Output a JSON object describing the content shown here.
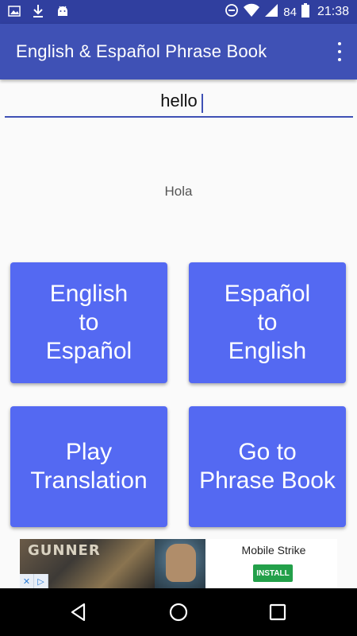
{
  "status_bar": {
    "battery_percent": "84",
    "time": "21:38",
    "left_icons": [
      "image-icon",
      "download-icon",
      "android-icon"
    ],
    "right_icons": [
      "sync-icon",
      "wifi-icon",
      "signal-icon",
      "battery-icon"
    ]
  },
  "app_bar": {
    "title": "English & Español Phrase Book",
    "menu_icon": "overflow-menu-icon"
  },
  "search": {
    "value": "hello",
    "placeholder": ""
  },
  "translation": {
    "text": "Hola"
  },
  "buttons": [
    {
      "label": "English\nto\nEspañol"
    },
    {
      "label": "Español\nto\nEnglish"
    },
    {
      "label": "Play\nTranslation"
    },
    {
      "label": "Go to\nPhrase Book"
    }
  ],
  "ad": {
    "banner_text": "GUNNER",
    "title": "Mobile Strike",
    "install_label": "INSTALL"
  },
  "nav_bar": {
    "icons": [
      "back-icon",
      "home-icon",
      "recents-icon"
    ]
  },
  "colors": {
    "status_bar": "#303f9f",
    "app_bar": "#3f51b5",
    "button": "#5469f2",
    "accent": "#3f51b5"
  }
}
